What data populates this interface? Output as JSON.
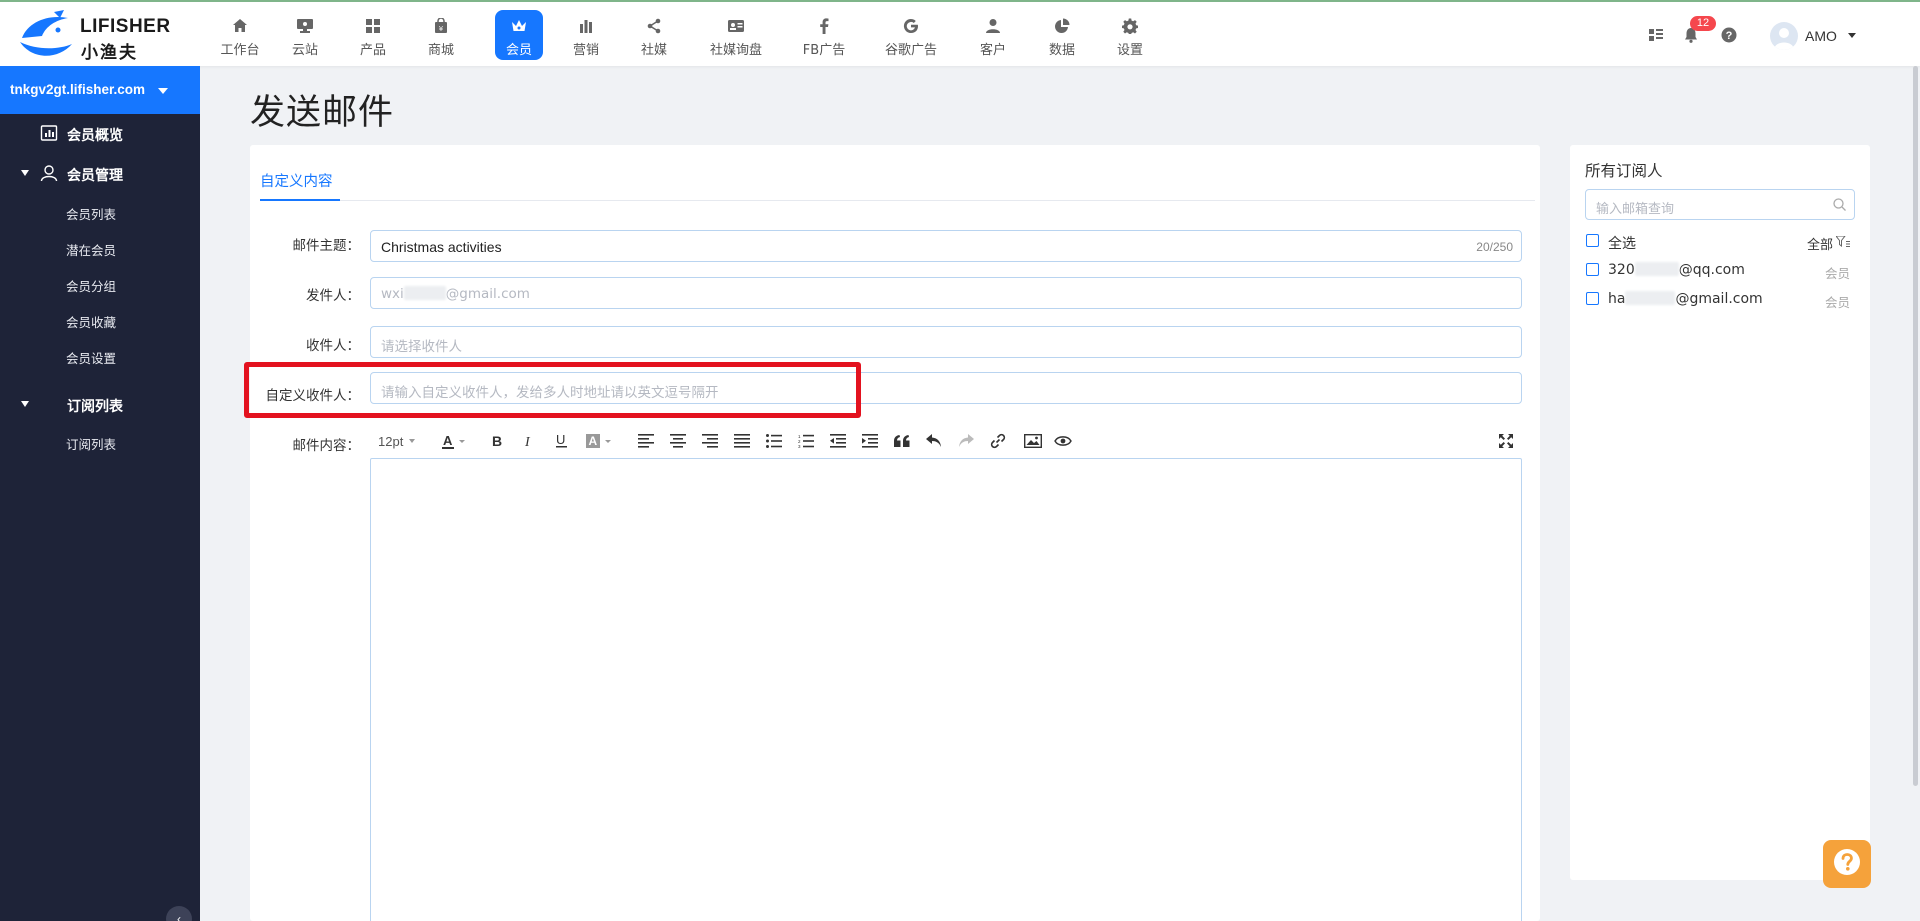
{
  "brand": {
    "name_en": "LIFISHER",
    "name_cn": "小渔夫",
    "primary_color": "#1677ff",
    "sidebar_color": "#1e2338"
  },
  "nav": {
    "items": [
      {
        "label": "工作台",
        "icon": "home-icon"
      },
      {
        "label": "云站",
        "icon": "monitor-icon"
      },
      {
        "label": "产品",
        "icon": "grid-icon"
      },
      {
        "label": "商城",
        "icon": "shopping-bag-icon"
      },
      {
        "label": "会员",
        "icon": "crown-icon",
        "active": true
      },
      {
        "label": "营销",
        "icon": "bar-chart-icon"
      },
      {
        "label": "社媒",
        "icon": "share-icon"
      },
      {
        "label": "社媒询盘",
        "icon": "id-card-icon"
      },
      {
        "label": "FB广告",
        "icon": "facebook-icon"
      },
      {
        "label": "谷歌广告",
        "icon": "google-icon"
      },
      {
        "label": "客户",
        "icon": "user-icon"
      },
      {
        "label": "数据",
        "icon": "pie-chart-icon"
      },
      {
        "label": "设置",
        "icon": "gear-icon"
      }
    ]
  },
  "header": {
    "notification_count": "12",
    "user_name": "AMO"
  },
  "sidebar": {
    "site": "tnkgv2gt.lifisher.com",
    "items": [
      {
        "label": "会员概览"
      },
      {
        "label": "会员管理"
      },
      {
        "label": "会员列表"
      },
      {
        "label": "潜在会员"
      },
      {
        "label": "会员分组"
      },
      {
        "label": "会员收藏"
      },
      {
        "label": "会员设置"
      },
      {
        "label": "订阅列表"
      },
      {
        "label": "订阅列表"
      }
    ]
  },
  "main": {
    "title": "发送邮件",
    "tab": "自定义内容",
    "form": {
      "subject_label": "邮件主题：",
      "subject_value": "Christmas activities",
      "subject_counter": "20/250",
      "sender_label": "发件人：",
      "sender_prefix": "wxi",
      "sender_suffix": "@gmail.com",
      "recipient_label": "收件人：",
      "recipient_placeholder": "请选择收件人",
      "custom_recipient_label": "自定义收件人：",
      "custom_recipient_placeholder": "请输入自定义收件人，发给多人时地址请以英文逗号隔开",
      "content_label": "邮件内容：",
      "font_size": "12pt"
    }
  },
  "subscribers": {
    "title": "所有订阅人",
    "search_placeholder": "输入邮箱查询",
    "select_all": "全选",
    "filter_label": "全部",
    "list": [
      {
        "prefix": "320",
        "suffix": "@qq.com",
        "tag": "会员"
      },
      {
        "prefix": "ha",
        "suffix": "@gmail.com",
        "tag": "会员"
      }
    ]
  }
}
